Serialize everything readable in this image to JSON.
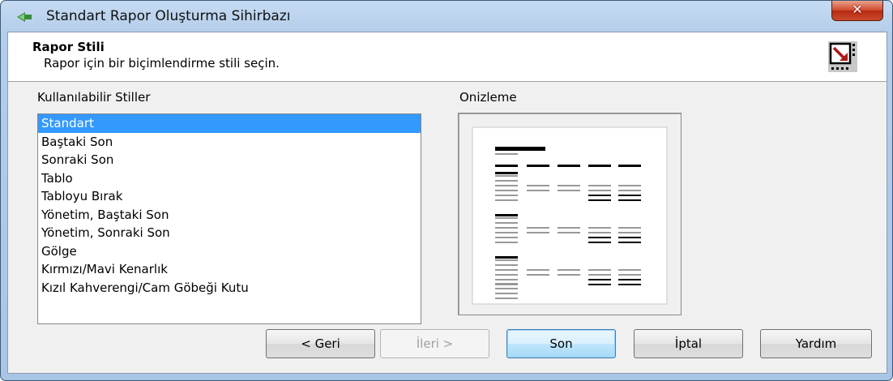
{
  "window": {
    "title": "Standart Rapor Oluşturma Sihirbazı"
  },
  "header": {
    "title": "Rapor Stili",
    "subtitle": "Rapor için bir biçimlendirme stili seçin."
  },
  "styles": {
    "label": "Kullanılabilir Stiller",
    "items": [
      "Standart",
      "Baştaki Son",
      "Sonraki Son",
      "Tablo",
      "Tabloyu Bırak",
      "Yönetim, Baştaki Son",
      "Yönetim, Sonraki Son",
      "Gölge",
      "Kırmızı/Mavi Kenarlık",
      "Kızıl Kahverengi/Cam Göbeği Kutu"
    ],
    "selected": "Standart"
  },
  "preview": {
    "label": "Onizleme"
  },
  "buttons": {
    "back": "< Geri",
    "next": "İleri >",
    "finish": "Son",
    "cancel": "İptal",
    "help": "Yardım"
  },
  "colors": {
    "selection": "#3399ff",
    "close_button": "#c9452b"
  },
  "icons": {
    "app": "wizard-arrow-icon",
    "header": "report-style-icon",
    "close": "close-icon"
  }
}
